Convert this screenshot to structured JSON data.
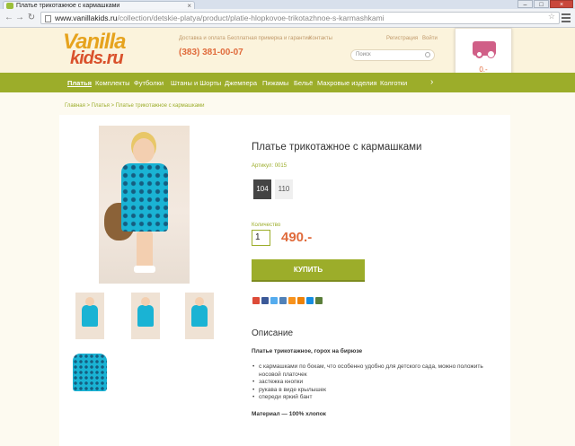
{
  "browser": {
    "tab_title": "Платье трикотажное с кармашками",
    "url_host": "www.vanillakids.ru",
    "url_path": "/collection/detskie-platya/product/platie-hlopkovoe-trikotazhnoe-s-karmashkami"
  },
  "header": {
    "logo_line1": "Vanilla",
    "logo_line2": "kids.ru",
    "links": [
      "Доставка и оплата",
      "Бесплатная примерка и гарантии",
      "Контакты"
    ],
    "register": "Регистрация",
    "login": "Войти",
    "phone": "(383) 381-00-07",
    "search_placeholder": "Поиск"
  },
  "cart": {
    "sum": "0.-"
  },
  "menu": {
    "items": [
      "Платья",
      "Комплекты",
      "Футболки",
      "Штаны и Шорты",
      "Джемпера",
      "Пижамы",
      "Бельё",
      "Махровые изделия",
      "Колготки"
    ],
    "more": "›"
  },
  "breadcrumb": "Главная > Платья > Платье трикотажное с кармашками",
  "product": {
    "title": "Платье трикотажное с кармашками",
    "sku": "Артикул: 0015",
    "sizes": [
      "104",
      "110"
    ],
    "selected_size": "104",
    "qty_label": "Количество",
    "qty": "1",
    "price": "490.-",
    "buy_label": "КУПИТЬ"
  },
  "share_colors": [
    "#dd4b39",
    "#3b5998",
    "#55acee",
    "#5181b8",
    "#f7931e",
    "#ee8208",
    "#168de2",
    "#5a7e3a"
  ],
  "description": {
    "heading": "Описание",
    "subtitle": "Платье трикотажное, горох на бирюзе",
    "bullets": [
      "с кармашками по бокам, что особенно удобно для детского сада, можно положить носовой платочек",
      "застежка кнопки",
      "рукава в виде крылышек",
      "спереди яркий бант"
    ],
    "material": "Материал — 100% хлопок"
  },
  "colors": {
    "accent": "#9cad2a",
    "price": "#e06b3c",
    "logo_orange": "#e6a31e",
    "logo_red": "#d9512c",
    "dress": "#1ab3d4"
  }
}
